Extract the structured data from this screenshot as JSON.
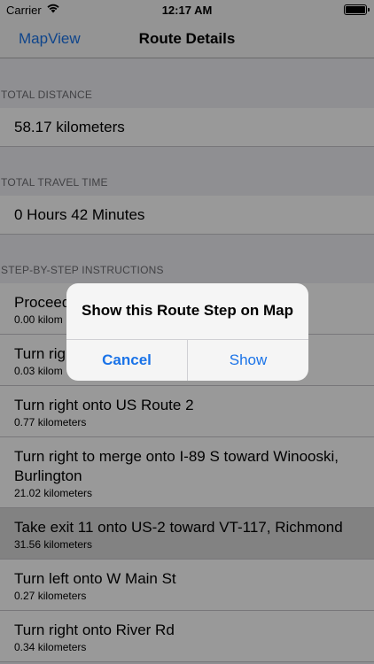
{
  "status_bar": {
    "carrier": "Carrier",
    "time": "12:17 AM"
  },
  "nav": {
    "back_label": "MapView",
    "title": "Route Details"
  },
  "sections": {
    "distance": {
      "header": "TOTAL DISTANCE",
      "value": "58.17 kilometers"
    },
    "time": {
      "header": "TOTAL TRAVEL TIME",
      "value": "0 Hours 42 Minutes"
    },
    "steps": {
      "header": "STEP-BY-STEP INSTRUCTIONS",
      "items": [
        {
          "instruction": "Proceed",
          "distance": "0.00 kilom"
        },
        {
          "instruction": "Turn rig",
          "distance": "0.03 kilom"
        },
        {
          "instruction": "Turn right onto US Route 2",
          "distance": "0.77 kilometers"
        },
        {
          "instruction": "Turn right to merge onto I-89 S toward Winooski, Burlington",
          "distance": "21.02 kilometers"
        },
        {
          "instruction": "Take exit 11 onto US-2 toward VT-117, Richmond",
          "distance": "31.56 kilometers"
        },
        {
          "instruction": "Turn left onto W Main St",
          "distance": "0.27 kilometers"
        },
        {
          "instruction": "Turn right onto River Rd",
          "distance": "0.34 kilometers"
        }
      ]
    }
  },
  "alert": {
    "message": "Show this Route Step on Map",
    "cancel_label": "Cancel",
    "show_label": "Show"
  },
  "colors": {
    "accent": "#1a73e8",
    "background": "#efeff4"
  }
}
